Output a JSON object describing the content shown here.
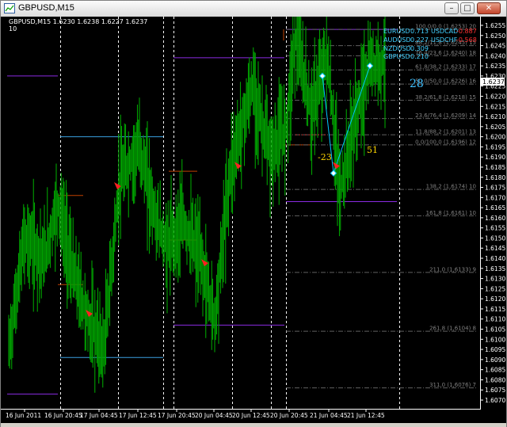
{
  "window": {
    "title": "GBPUSD,M15",
    "min_glyph": "–",
    "max_glyph": "□",
    "close_glyph": "✕"
  },
  "chart": {
    "header_line1": "GBPUSD,M15 1.6230 1.6238 1.6227 1.6237",
    "header_line2": "10",
    "current_price_label": "1.6237",
    "colors": {
      "background": "#000000",
      "candles": "#00a000",
      "grid": "#ffffff",
      "axis_text": "#ffffff",
      "fib_text": "#808080",
      "fib_line": "#606060",
      "purple_level": "#8a2be2",
      "blue_level": "#3aa0e0",
      "orange_level": "#c04000",
      "arrow": "#ff2020",
      "zigzag": "#00c8ff",
      "annotation_yellow": "#ffd700",
      "counter_cyan": "#40c0ff"
    },
    "price_axis": [
      "1.6255",
      "1.6250",
      "1.6245",
      "1.6240",
      "1.6235",
      "1.6230",
      "1.6225",
      "1.6220",
      "1.6215",
      "1.6210",
      "1.6205",
      "1.6200",
      "1.6195",
      "1.6190",
      "1.6185",
      "1.6180",
      "1.6175",
      "1.6170",
      "1.6165",
      "1.6160",
      "1.6155",
      "1.6150",
      "1.6145",
      "1.6140",
      "1.6135",
      "1.6130",
      "1.6125",
      "1.6120",
      "1.6115",
      "1.6110",
      "1.6105",
      "1.6100",
      "1.6095",
      "1.6090",
      "1.6085",
      "1.6080",
      "1.6075",
      "1.6070"
    ],
    "time_axis": [
      "16 Jun 2011",
      "16 Jun 20:45",
      "17 Jun 04:45",
      "17 Jun 12:45",
      "17 Jun 20:45",
      "20 Jun 04:45",
      "20 Jun 12:45",
      "20 Jun 20:45",
      "21 Jun 04:45",
      "21 Jun 12:45"
    ],
    "correlation_table": [
      {
        "symbol": "EURUSD",
        "value": "0.713",
        "color": "#40d0ff"
      },
      {
        "symbol": "USDCAD",
        "value": "-0.887",
        "color": "#ff3030"
      },
      {
        "symbol": "AUDUSD",
        "value": "0.227",
        "color": "#40d0ff"
      },
      {
        "symbol": "USDCHF",
        "value": "-0.568",
        "color": "#ff3030"
      },
      {
        "symbol": "NZDUSD",
        "value": "0.309",
        "color": "#40d0ff"
      },
      {
        "symbol": "GBPUSD",
        "value": "0.210",
        "color": "#40d0ff"
      }
    ],
    "fib_labels": [
      "100,0/0,0 (1,6253) 20",
      "88,2/11,8 (1,6245) 15",
      "76,4/23,6 (1,6240) 18",
      "61,8/38,2 (1,6233) 17",
      "50,0/50,0 (1,6226) 16",
      "38,2/61,8 (1,6218) 15",
      "23,6/76,4 (1,6209) 14",
      "11,8/88,2 (1,6201) 13",
      "0,0/100,0 (1,6196) 12",
      "138,2 (1,6174) 10",
      "161,8 (1,6161) 10",
      "211,0 (1,6133) 9",
      "261,8 (1,6104) 8",
      "311,0 (1,6076) 7"
    ],
    "annotations": {
      "counter": "28",
      "neg_value": "-23",
      "pos_value": "51"
    }
  }
}
